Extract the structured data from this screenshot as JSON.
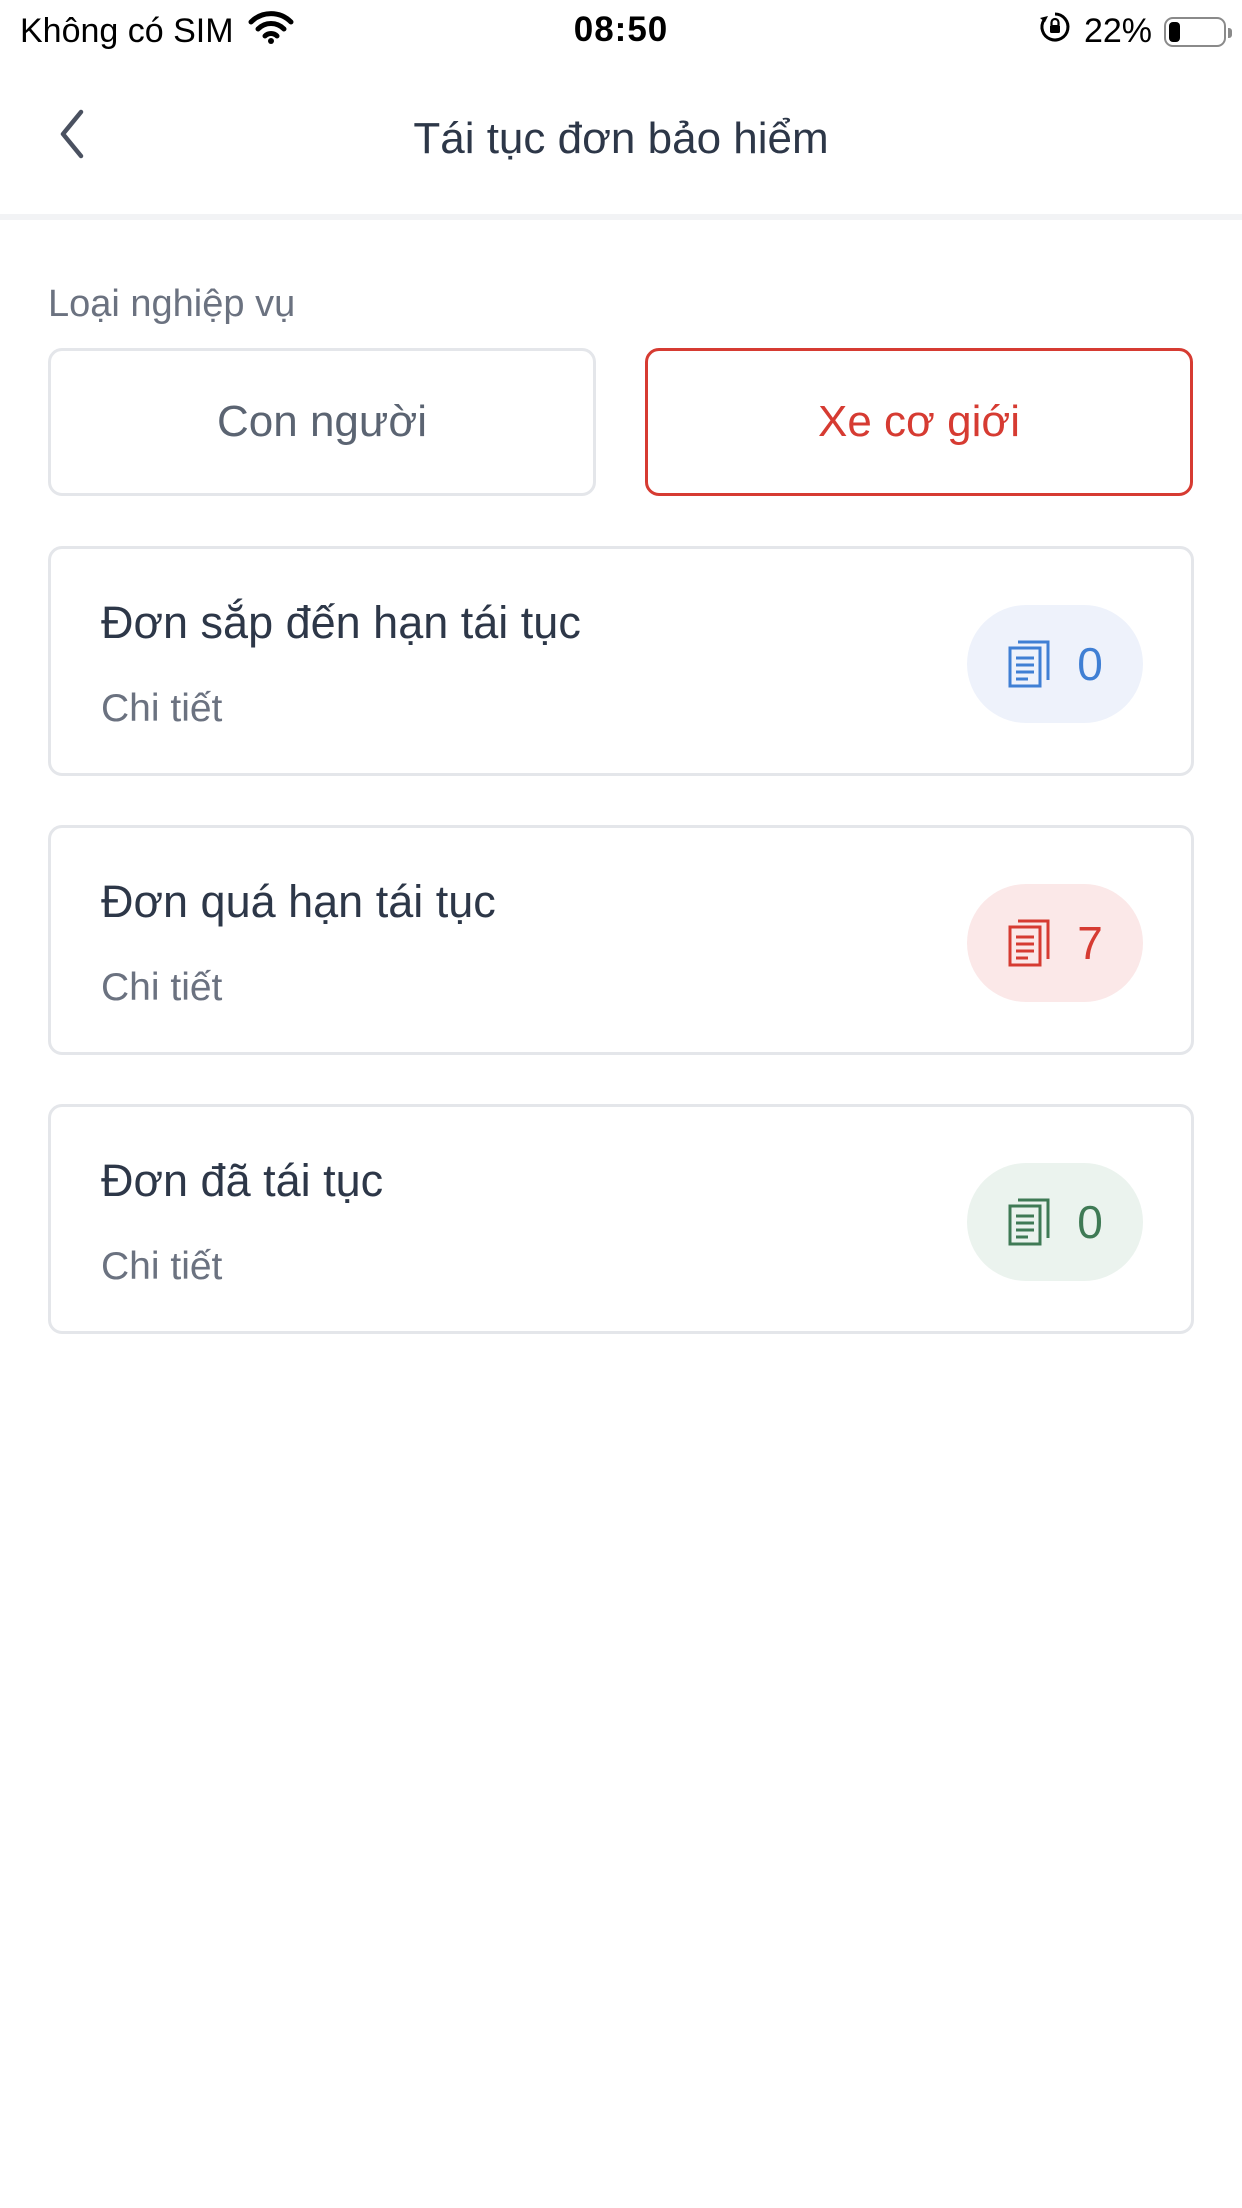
{
  "status_bar": {
    "carrier": "Không có SIM",
    "time": "08:50",
    "battery_percent": "22%",
    "battery_level": 0.22,
    "icons": [
      "wifi-icon",
      "rotation-lock-icon",
      "battery-icon"
    ]
  },
  "header": {
    "title": "Tái tục đơn bảo hiểm",
    "back_icon": "chevron-left-icon"
  },
  "business_type": {
    "label": "Loại nghiệp vụ",
    "options": [
      "Con người",
      "Xe cơ giới"
    ],
    "selected": "Xe cơ giới"
  },
  "cards": [
    {
      "title": "Đơn sắp đến hạn tái tục",
      "subtitle": "Chi tiết",
      "count": "0",
      "color": "#3f7fd4",
      "icon": "document-icon"
    },
    {
      "title": "Đơn quá hạn tái tục",
      "subtitle": "Chi tiết",
      "count": "7",
      "color": "#d63b32",
      "icon": "document-icon"
    },
    {
      "title": "Đơn đã tái tục",
      "subtitle": "Chi tiết",
      "count": "0",
      "color": "#3f7a55",
      "icon": "document-icon"
    }
  ],
  "colors": {
    "accent": "#d63b32",
    "text_primary": "#2d3748",
    "text_secondary": "#6b7280",
    "border": "#e4e6ea"
  }
}
